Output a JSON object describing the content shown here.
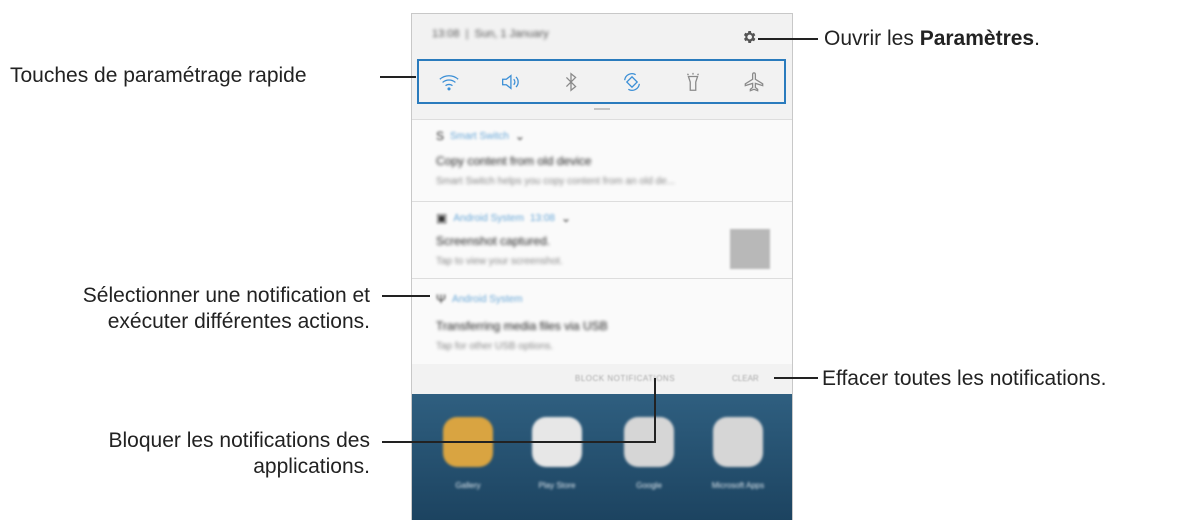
{
  "status_bar": {
    "time": "13:08",
    "date": "Sun, 1 January"
  },
  "quick_settings": {
    "icons": [
      "wifi-icon",
      "sound-icon",
      "bluetooth-icon",
      "auto-rotate-icon",
      "flashlight-icon",
      "airplane-mode-icon"
    ],
    "active_color": "#3b8fd6",
    "inactive_color": "#8a8a8a"
  },
  "notifications": [
    {
      "app": "Smart Switch",
      "title": "Copy content from old device",
      "text": "Smart Switch helps you copy content from an old de..."
    },
    {
      "app": "Android System",
      "time": "13:08",
      "title": "Screenshot captured.",
      "text": "Tap to view your screenshot."
    },
    {
      "app": "Android System",
      "title": "Transferring media files via USB",
      "text": "Tap for other USB options."
    }
  ],
  "actions": {
    "block": "BLOCK NOTIFICATIONS",
    "clear": "CLEAR"
  },
  "home_apps": [
    "Gallery",
    "Play Store",
    "Google",
    "Microsoft Apps"
  ],
  "callouts": {
    "quick": "Touches de paramétrage rapide",
    "settings_prefix": "Ouvrir les ",
    "settings_bold": "Paramètres",
    "settings_suffix": ".",
    "select_line1": "Sélectionner une notification et",
    "select_line2": "exécuter différentes actions.",
    "clear": "Effacer toutes les notifications.",
    "block_line1": "Bloquer les notifications des",
    "block_line2": "applications."
  },
  "colors": {
    "frame_border": "#2a7bbd",
    "home_bg": "#2f5f80"
  }
}
